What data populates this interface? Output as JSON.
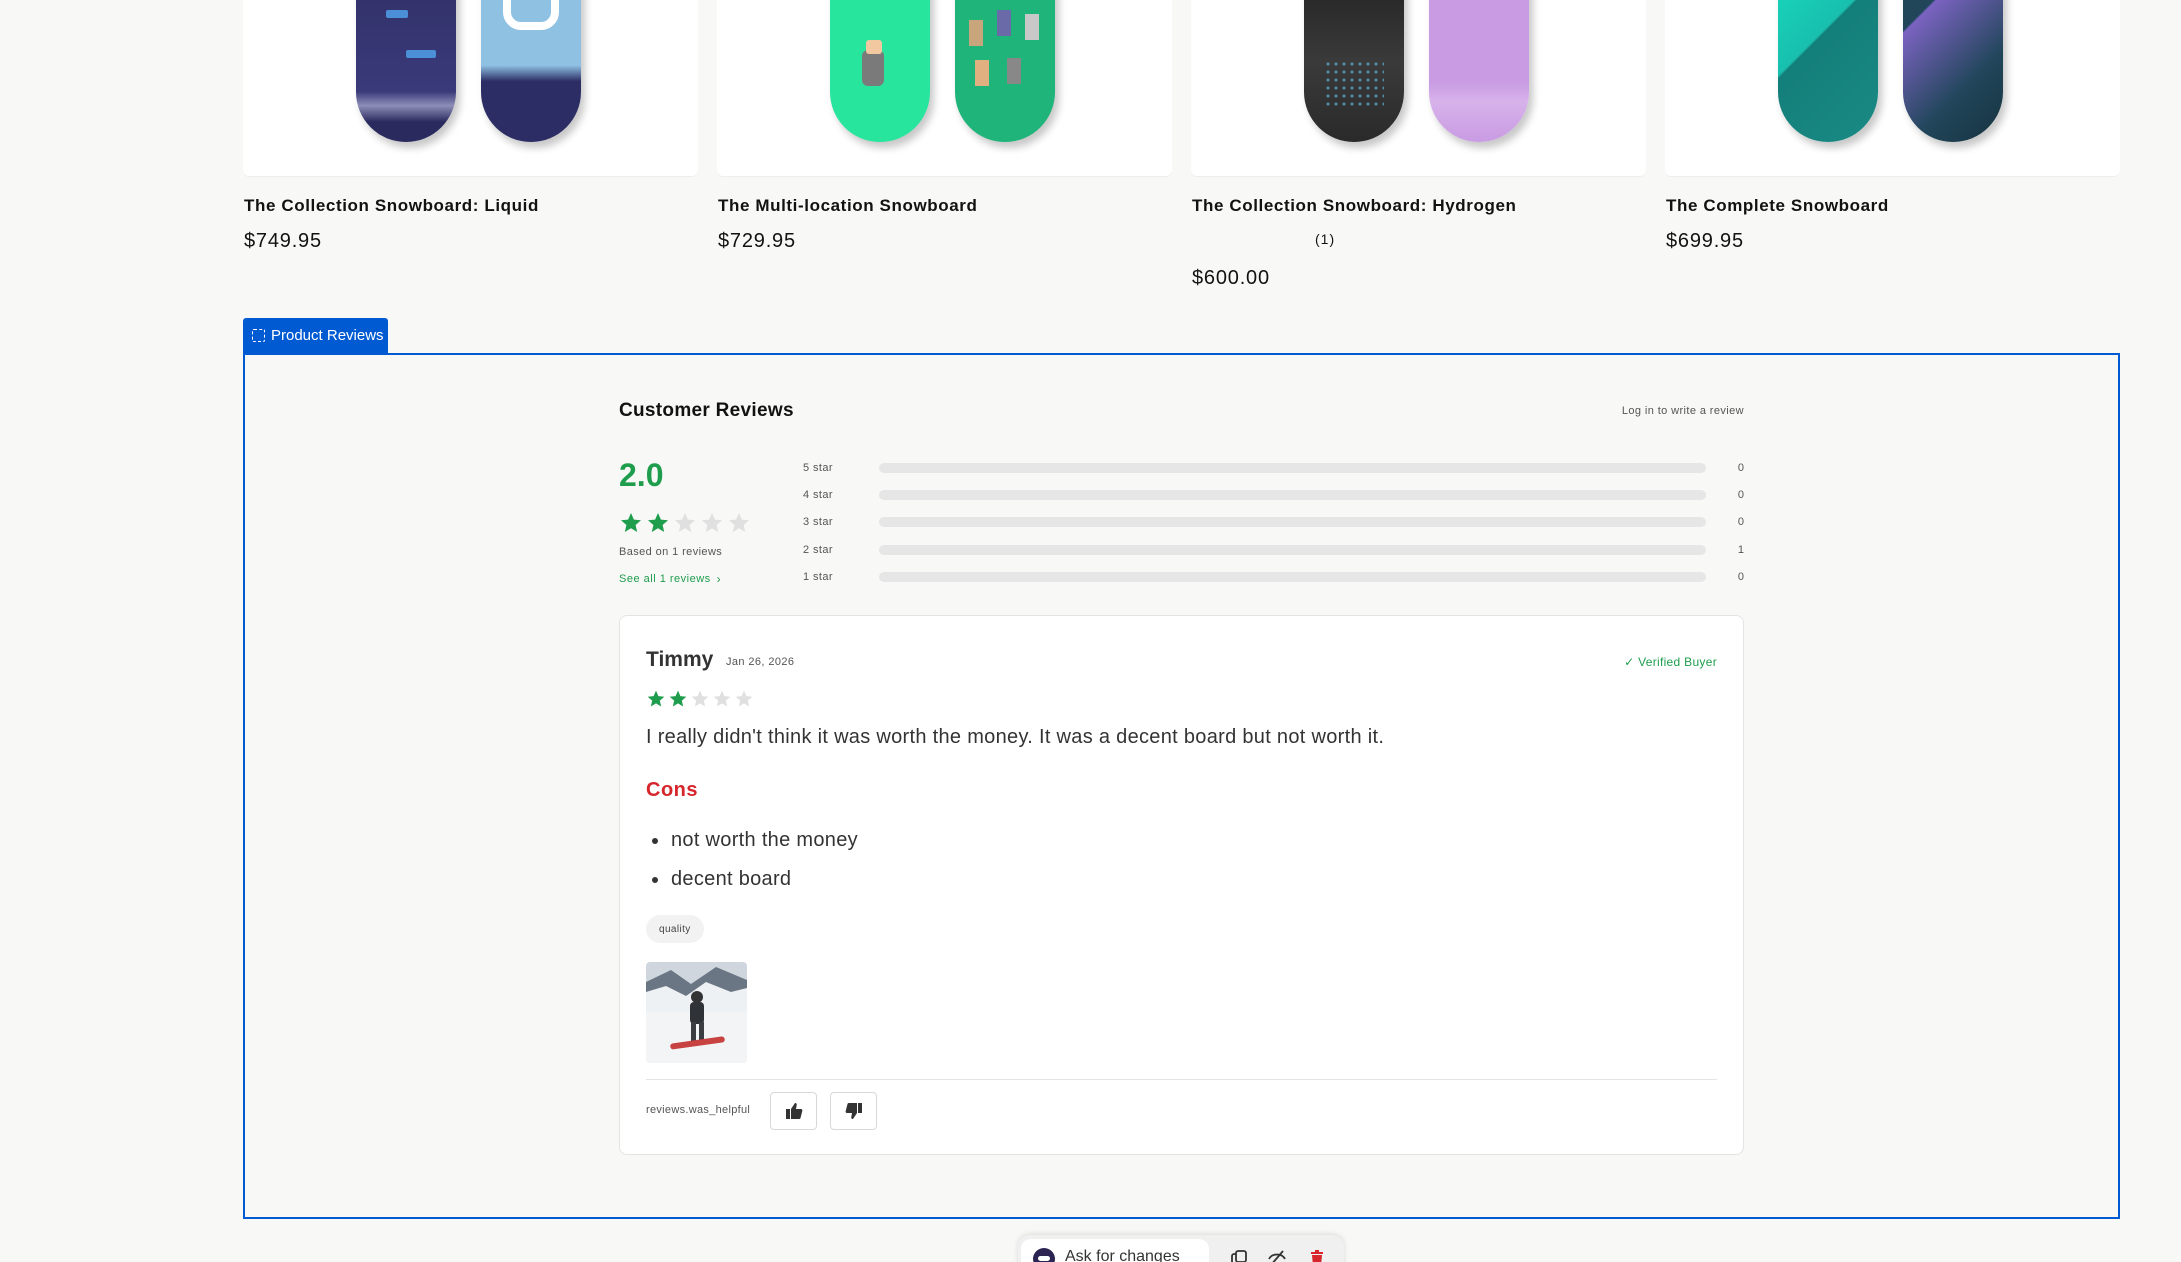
{
  "products": [
    {
      "title": "The Collection Snowboard: Liquid",
      "price": "$749.95",
      "rating_count": "",
      "colors": {
        "left": "#2e2d63",
        "right": "#8fc1e3",
        "accent": "#ffffff"
      }
    },
    {
      "title": "The Multi-location Snowboard",
      "price": "$729.95",
      "rating_count": "",
      "colors": {
        "left": "#28e59e",
        "right": "#1fb47a",
        "accent": "#ffffff"
      }
    },
    {
      "title": "The Collection Snowboard: Hydrogen",
      "price": "$600.00",
      "rating_count": "(1)",
      "colors": {
        "left": "#2a2a2a",
        "right": "#c99be3",
        "accent": "#5aa9c9"
      }
    },
    {
      "title": "The Complete Snowboard",
      "price": "$699.95",
      "rating_count": "",
      "colors": {
        "left": "#18bfae",
        "right": "#21465a",
        "accent": "#7b63c1"
      }
    }
  ],
  "section_tag": {
    "label": "Product Reviews"
  },
  "reviews": {
    "heading": "Customer Reviews",
    "write_review": "Log in to write a review",
    "average": "2.0",
    "average_value": 2,
    "based_on": "Based on 1 reviews",
    "see_all": "See all 1 reviews",
    "histogram": [
      {
        "label": "5 star",
        "count": "0",
        "fraction": 0
      },
      {
        "label": "4 star",
        "count": "0",
        "fraction": 0
      },
      {
        "label": "3 star",
        "count": "0",
        "fraction": 0
      },
      {
        "label": "2 star",
        "count": "1",
        "fraction": 0
      },
      {
        "label": "1 star",
        "count": "0",
        "fraction": 0
      }
    ]
  },
  "review": {
    "name": "Timmy",
    "date": "Jan 26, 2026",
    "verified": "✓ Verified Buyer",
    "rating": 2,
    "body": "I really didn't think it was worth the money. It was a decent board but not worth it.",
    "cons_heading": "Cons",
    "cons": [
      "not worth the money",
      "decent board"
    ],
    "tag": "quality",
    "helpful_label": "reviews.was_helpful"
  },
  "toolbar": {
    "ask_label": "Ask for changes"
  },
  "colors": {
    "accent": "#005bd3",
    "star_filled": "#1e9d4d",
    "star_empty": "#e0e0e0",
    "cons": "#d6252b"
  }
}
